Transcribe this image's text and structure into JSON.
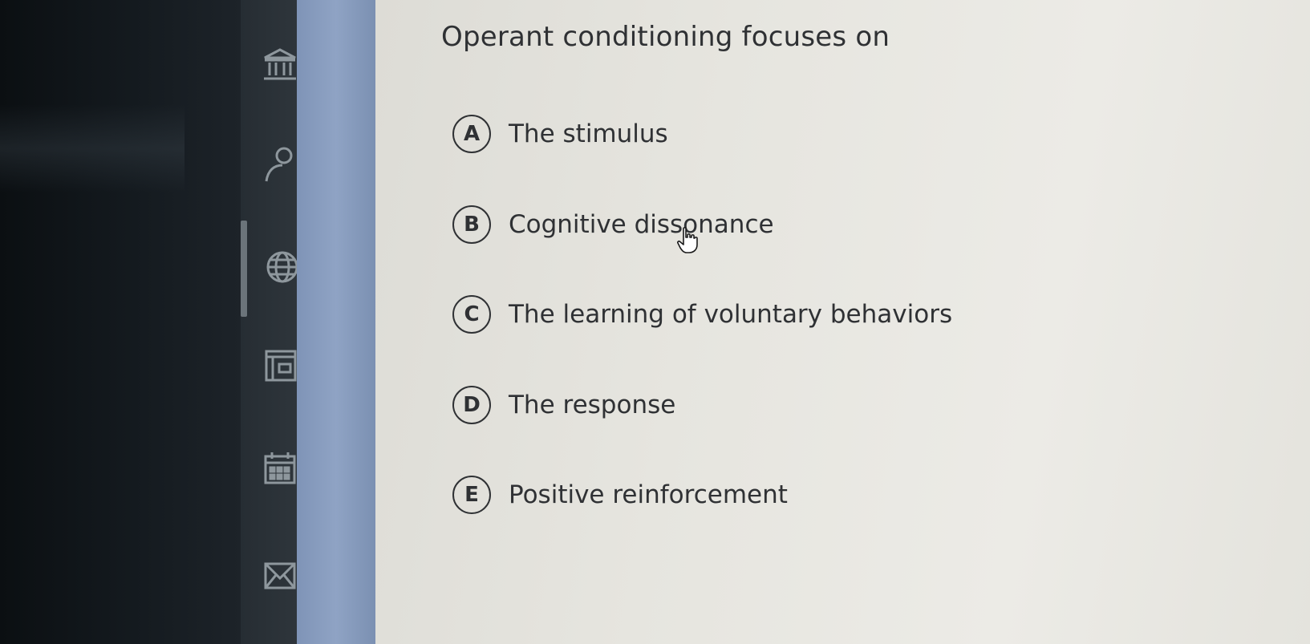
{
  "question": {
    "text": "Operant conditioning focuses on"
  },
  "options": [
    {
      "letter": "A",
      "text": "The stimulus"
    },
    {
      "letter": "B",
      "text": "Cognitive dissonance"
    },
    {
      "letter": "C",
      "text": "The learning of voluntary behaviors"
    },
    {
      "letter": "D",
      "text": "The response"
    },
    {
      "letter": "E",
      "text": "Positive reinforcement"
    }
  ],
  "sidebar": {
    "icons": [
      "institution-icon",
      "person-icon",
      "globe-icon",
      "layout-icon",
      "calendar-icon",
      "mail-icon"
    ]
  },
  "colors": {
    "text": "#2f3134",
    "content_background": "#e6e5df",
    "accent_strip": "#8fa3c4",
    "rail": "#2e353b"
  }
}
